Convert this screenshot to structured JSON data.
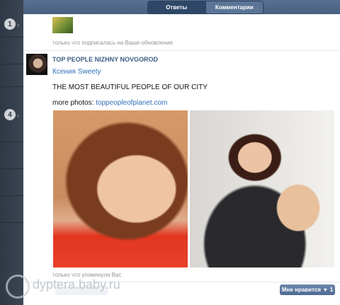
{
  "topbar": {
    "tabs": [
      "Ответы",
      "Комментарии"
    ]
  },
  "sidebar": {
    "badges": [
      "1",
      "4"
    ]
  },
  "feed": {
    "notice_subscribed": "только что подписалась на Ваши обновления",
    "post": {
      "group": "TOP PEOPLE NIZHNY NOVGOROD",
      "author": "Ксения Sweety",
      "headline": "THE MOST BEAUTIFUL PEOPLE OF OUR CITY",
      "more_label": "more photos:",
      "more_link": "toppeopleofplanet.com"
    },
    "notice_mentioned": "только что упомянули Вас",
    "like_label": "Мне нравится",
    "like_count": "1"
  },
  "watermark": "dyptera.baby.ru"
}
